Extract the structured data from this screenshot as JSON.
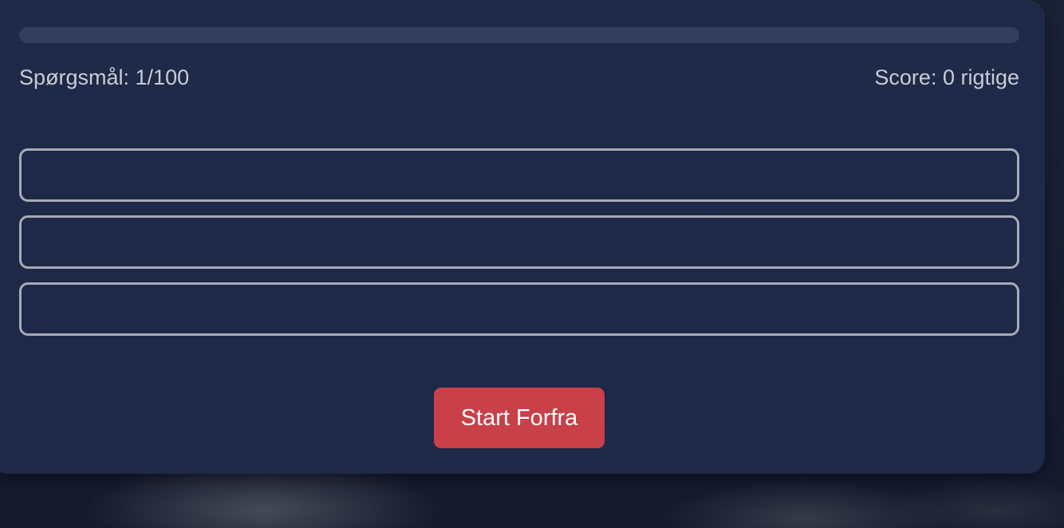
{
  "progress": {
    "fraction": 0.0,
    "question_label": "Spørgsmål: 1/100",
    "score_label": "Score: 0 rigtige"
  },
  "question": {
    "text": ""
  },
  "answers": [
    {
      "label": ""
    },
    {
      "label": ""
    },
    {
      "label": ""
    }
  ],
  "controls": {
    "restart_label": "Start Forfra"
  },
  "colors": {
    "card_background": "#1f2a4a",
    "progress_track": "#323e5c",
    "answer_border": "#a7abb6",
    "restart_button": "#ca4048",
    "stats_text": "#c9ccd4"
  }
}
